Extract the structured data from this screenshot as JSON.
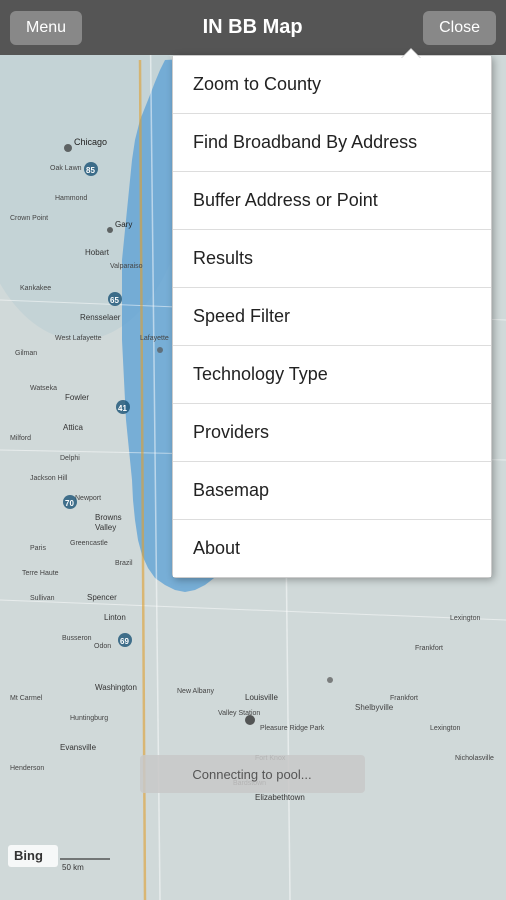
{
  "header": {
    "title": "IN BB Map",
    "menu_label": "Menu",
    "close_label": "Close"
  },
  "menu": {
    "items": [
      {
        "id": "zoom-county",
        "label": "Zoom to County"
      },
      {
        "id": "find-broadband",
        "label": "Find Broadband By Address"
      },
      {
        "id": "buffer-address",
        "label": "Buffer Address or Point"
      },
      {
        "id": "results",
        "label": "Results"
      },
      {
        "id": "speed-filter",
        "label": "Speed Filter"
      },
      {
        "id": "technology-type",
        "label": "Technology Type"
      },
      {
        "id": "providers",
        "label": "Providers"
      },
      {
        "id": "basemap",
        "label": "Basemap"
      },
      {
        "id": "about",
        "label": "About"
      }
    ]
  },
  "map": {
    "connecting_text": "Connecting to pool...",
    "bing_label": "Bing"
  }
}
